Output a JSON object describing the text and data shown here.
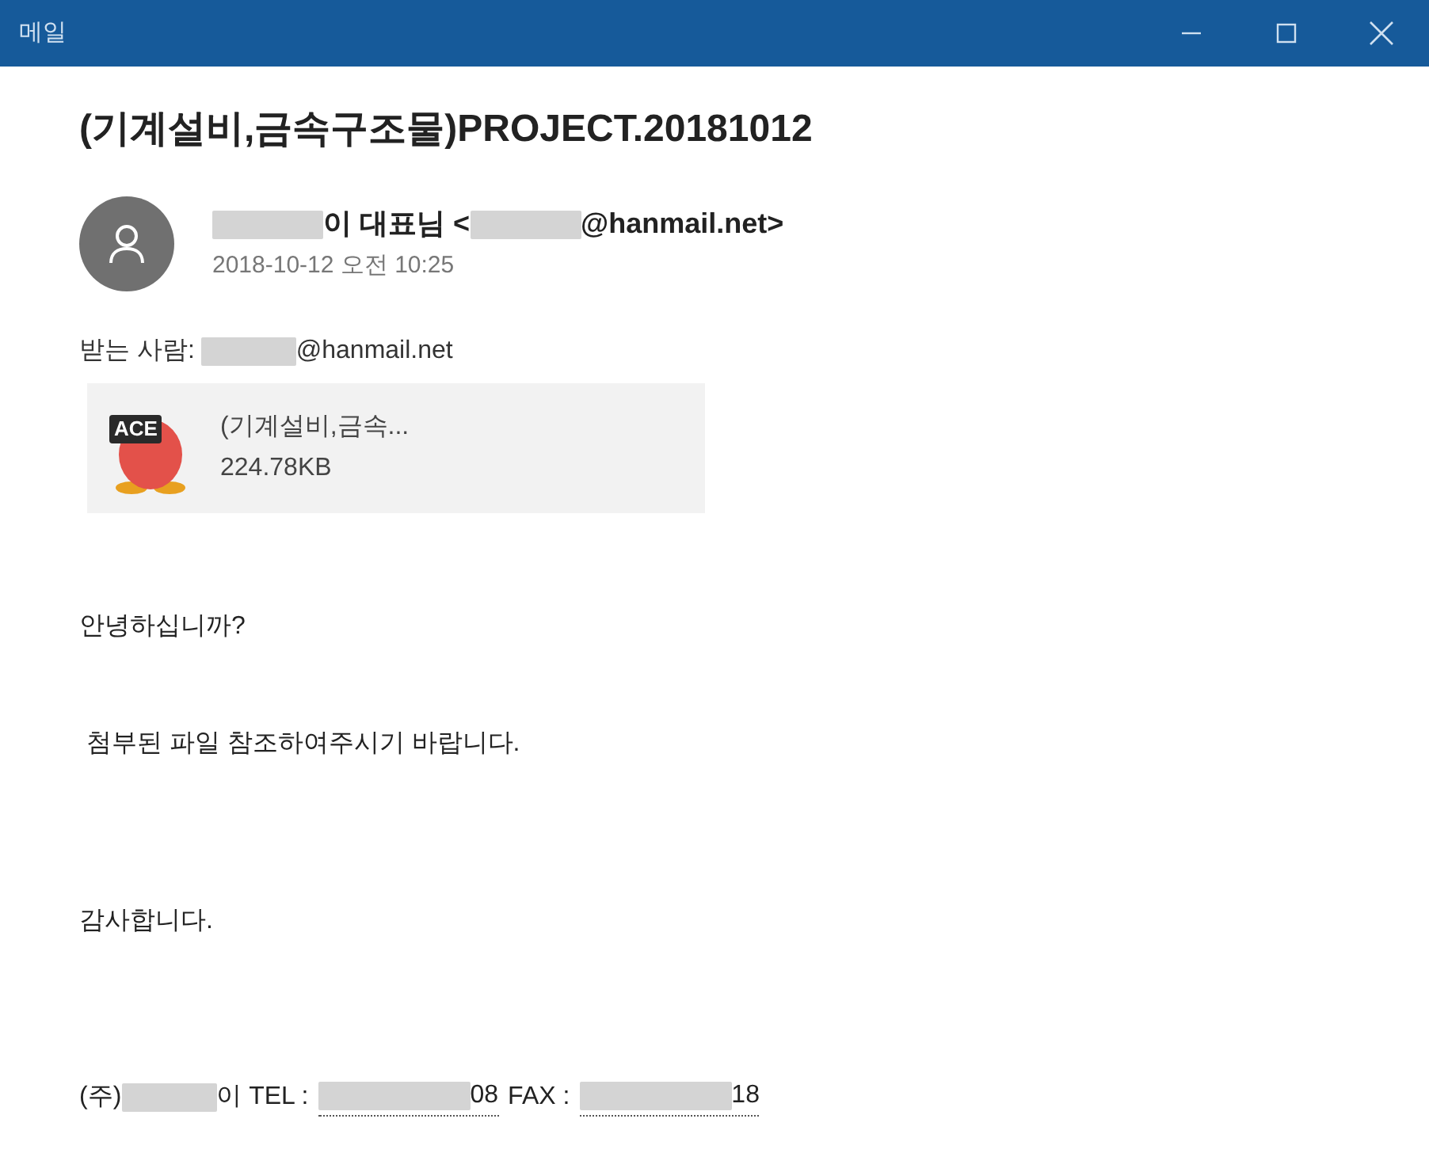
{
  "window": {
    "title": "메일"
  },
  "subject": "(기계설비,금속구조물)PROJECT.20181012",
  "sender": {
    "parts": [
      {
        "kind": "redacted"
      },
      {
        "kind": "text",
        "text": "이 대표님 <"
      },
      {
        "kind": "redacted"
      },
      {
        "kind": "text",
        "text": "@hanmail.net>"
      }
    ],
    "date": "2018-10-12 오전 10:25"
  },
  "to": {
    "label": "받는 사람:",
    "parts": [
      {
        "kind": "redacted"
      },
      {
        "kind": "text",
        "text": "@hanmail.net"
      }
    ]
  },
  "attachment": {
    "name": "(기계설비,금속...",
    "size": "224.78KB",
    "badge": "ACE"
  },
  "body": [
    {
      "kind": "line",
      "text": "안녕하십니까?"
    },
    {
      "kind": "line",
      "text": " 첨부된 파일 참조하여주시기 바랍니다."
    },
    {
      "kind": "line",
      "text": "감사합니다."
    }
  ],
  "signature": [
    {
      "kind": "text",
      "text": "(주)"
    },
    {
      "kind": "redacted"
    },
    {
      "kind": "text",
      "text": "이 TEL :"
    },
    {
      "kind": "phone",
      "text": "08"
    },
    {
      "kind": "text",
      "text": "FAX :"
    },
    {
      "kind": "phone",
      "text": "18"
    }
  ]
}
